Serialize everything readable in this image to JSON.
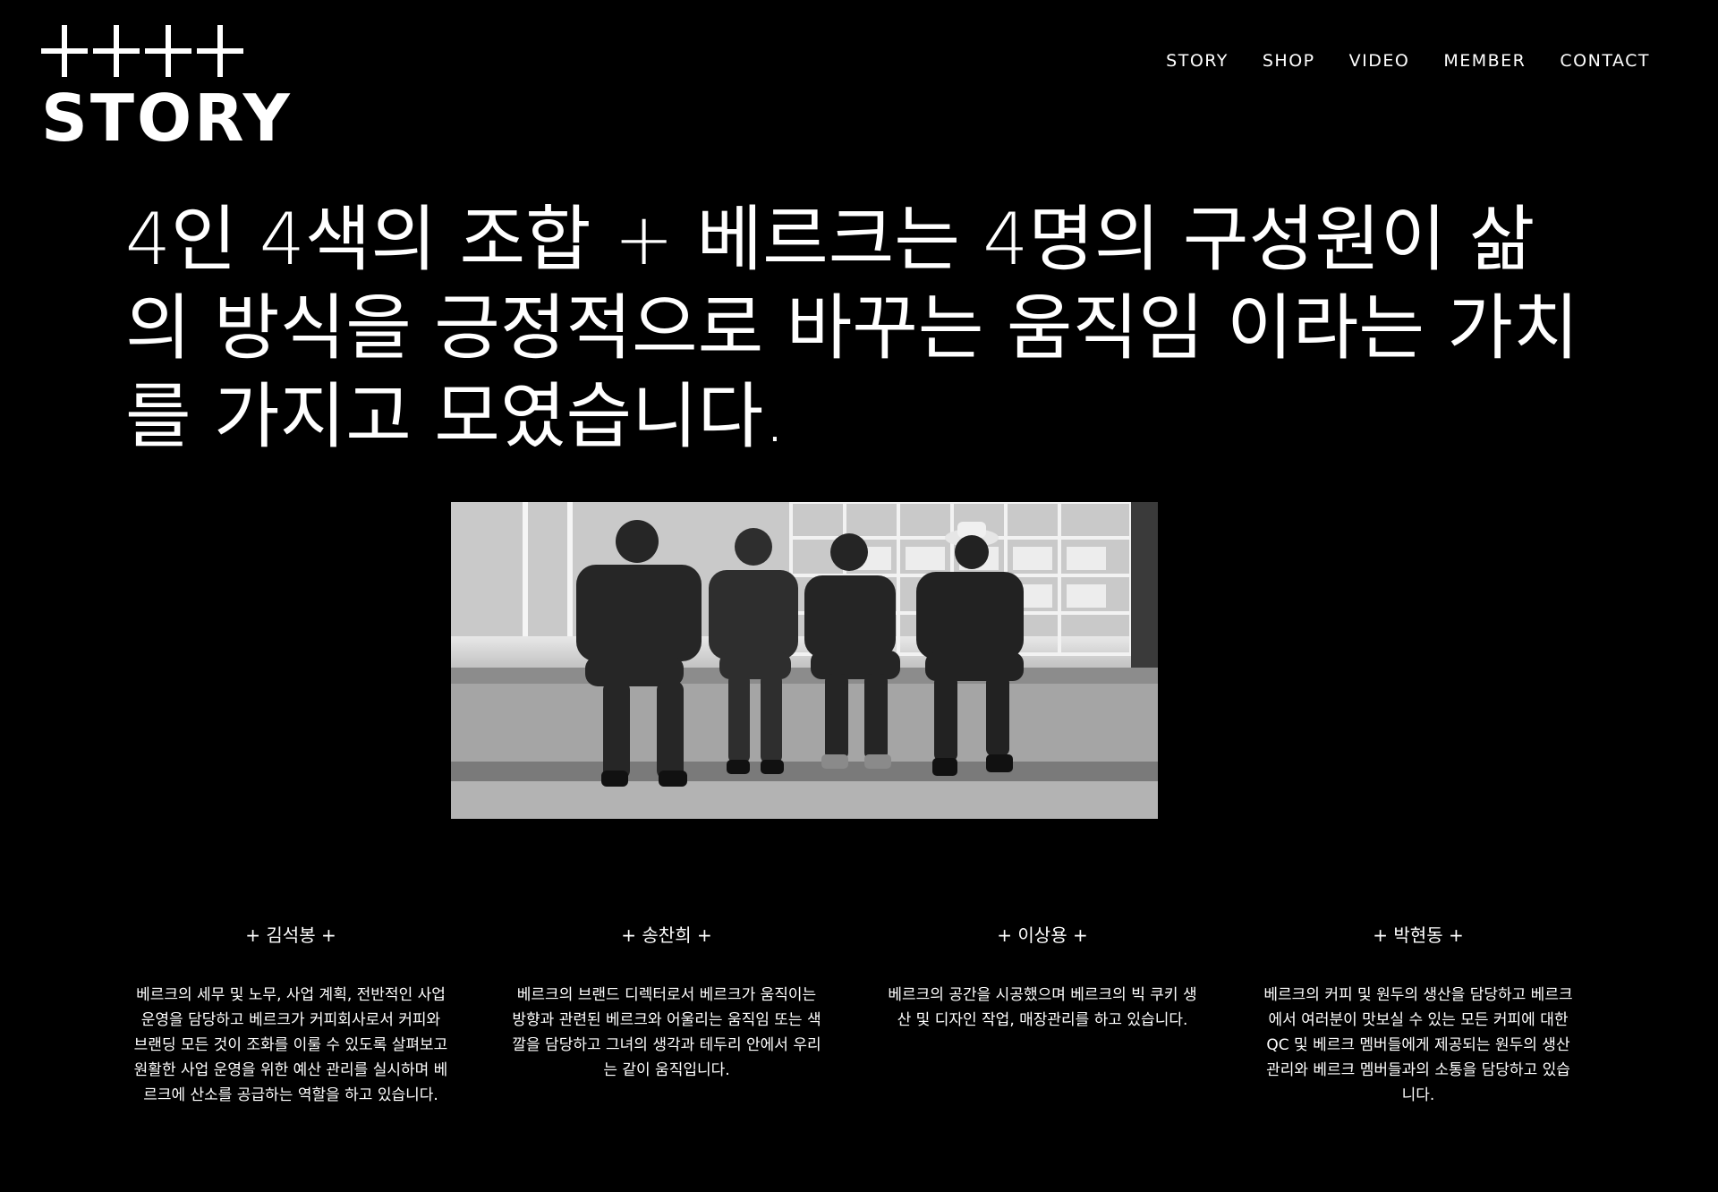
{
  "logo": {
    "mark": "++++",
    "title": "STORY"
  },
  "nav": {
    "items": [
      "STORY",
      "SHOP",
      "VIDEO",
      "MEMBER",
      "CONTACT"
    ]
  },
  "headline": "4인 4색의 조합 + 베르크는 4명의 구성원이 삶의 방식을 긍정적으로 바꾸는 움직임 이라는 가치를 가지고 모였습니다.",
  "members": [
    {
      "name": "+ 김석봉 +",
      "description": "베르크의 세무 및 노무, 사업 계획, 전반적인 사업 운영을 담당하고 베르크가 커피회사로서 커피와 브랜딩 모든 것이 조화를 이룰 수 있도록 살펴보고 원활한 사업 운영을 위한 예산 관리를 실시하며 베르크에 산소를 공급하는 역할을 하고 있습니다."
    },
    {
      "name": "+ 송찬희 +",
      "description": "베르크의 브랜드 디렉터로서 베르크가 움직이는 방향과 관련된 베르크와 어울리는 움직임 또는 색깔을 담당하고 그녀의 생각과 테두리 안에서 우리는 같이 움직입니다."
    },
    {
      "name": "+ 이상용 +",
      "description": "베르크의 공간을 시공했으며 베르크의 빅 쿠키 생산 및 디자인 작업, 매장관리를 하고 있습니다."
    },
    {
      "name": "+ 박현동 +",
      "description": "베르크의 커피 및 원두의 생산을 담당하고 베르크에서 여러분이 맛보실 수 있는 모든 커피에 대한 QC 및 베르크 멤버들에게 제공되는 원두의 생산 관리와 베르크 멤버들과의 소통을 담당하고 있습니다."
    }
  ]
}
